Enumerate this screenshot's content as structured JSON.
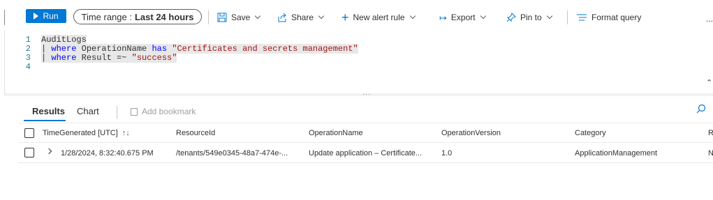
{
  "toolbar": {
    "run_label": "Run",
    "time_range_prefix": "Time range :",
    "time_range_value": "Last 24 hours",
    "save_label": "Save",
    "share_label": "Share",
    "new_alert_label": "New alert rule",
    "export_label": "Export",
    "pin_label": "Pin to",
    "format_label": "Format query",
    "more": "..."
  },
  "editor": {
    "line_numbers": [
      "1",
      "2",
      "3",
      "4"
    ],
    "line1": "AuditLogs",
    "line2_pipe": "| ",
    "line2_kw1": "where",
    "line2_field": " OperationName ",
    "line2_kw2": "has",
    "line2_str": " \"Certificates and secrets management\"",
    "line3_pipe": "| ",
    "line3_kw": "where",
    "line3_field": " Result =~ ",
    "line3_str": "\"success\""
  },
  "splitter_dots": "...",
  "results": {
    "tab_results": "Results",
    "tab_chart": "Chart",
    "add_bookmark": "Add bookmark",
    "columns": [
      "TimeGenerated [UTC]",
      "ResourceId",
      "OperationName",
      "OperationVersion",
      "Category",
      "R"
    ],
    "sort_glyph": "↑↓",
    "rows": [
      [
        "1/28/2024, 8:32:40.675 PM",
        "/tenants/549e0345-48a7-474e-...",
        "Update application – Certificate...",
        "1.0",
        "ApplicationManagement",
        "N"
      ]
    ]
  }
}
